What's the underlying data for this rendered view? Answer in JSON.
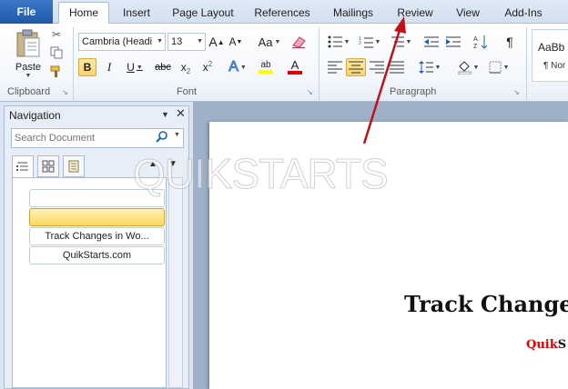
{
  "tabs": {
    "file": "File",
    "items": [
      "Home",
      "Insert",
      "Page Layout",
      "References",
      "Mailings",
      "Review",
      "View",
      "Add-Ins"
    ],
    "active": "Home"
  },
  "ribbon": {
    "clipboard": {
      "label": "Clipboard",
      "paste": "Paste"
    },
    "font": {
      "label": "Font",
      "name": "Cambria (Headi",
      "size": "13",
      "grow": "A",
      "shrink": "A",
      "case": "Aa",
      "bold": "B",
      "italic": "I",
      "underline": "U",
      "strike": "abc",
      "subscript": "x",
      "superscript": "x",
      "sub_mark": "2",
      "highlight": "ab",
      "color": "A"
    },
    "paragraph": {
      "label": "Paragraph",
      "pilcrow": "¶"
    },
    "styles": {
      "sample": "AaBb",
      "normal": "¶ Nor"
    }
  },
  "navigation": {
    "title": "Navigation",
    "search_placeholder": "Search Document",
    "headings": [
      "",
      "",
      "Track Changes in Wo...",
      "QuikStarts.com"
    ]
  },
  "document": {
    "title": "Track Change",
    "sub_red": "Quik",
    "sub_black": "S"
  },
  "watermark": "QUIKSTARTS",
  "colors": {
    "file_tab": "#2a66b8",
    "accent_red": "#e00000",
    "selected": "#f8d36b"
  }
}
